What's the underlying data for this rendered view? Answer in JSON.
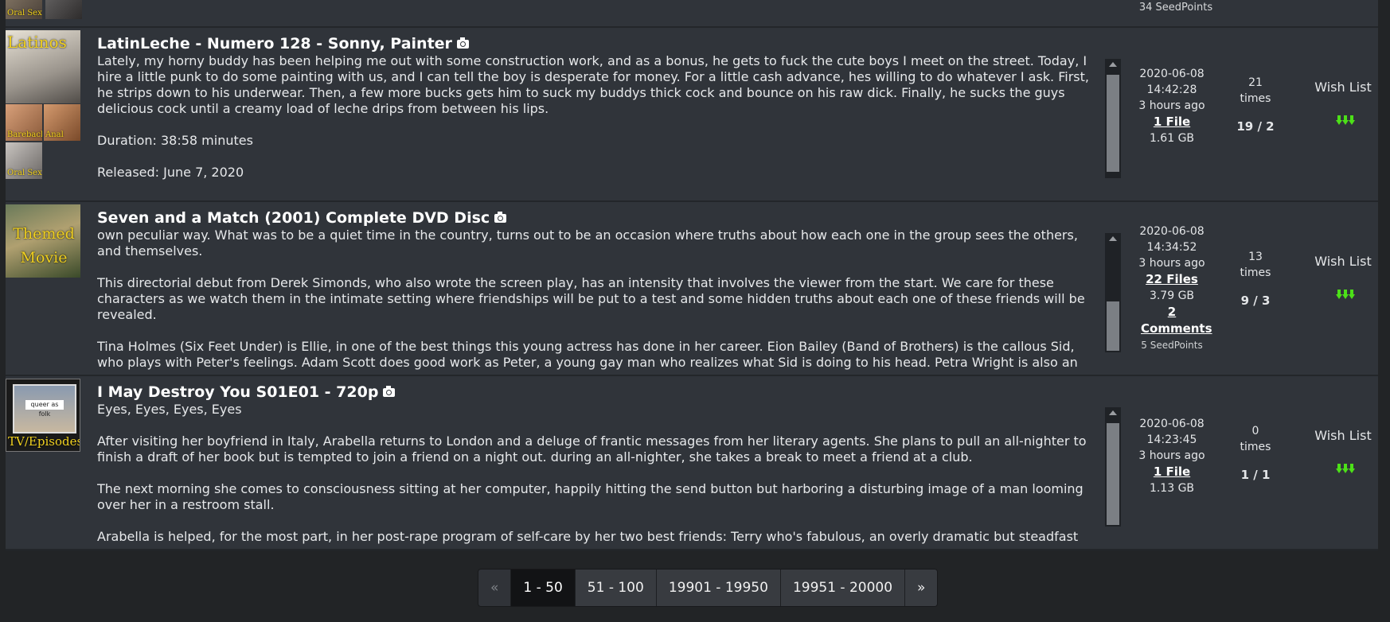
{
  "previous_row": {
    "seedpoints": "34 SeedPoints",
    "thumb_label": "Oral Sex"
  },
  "items": [
    {
      "title": "LatinLeche - Numero 128 - Sonny, Painter",
      "thumbs": [
        "Latinos",
        "Bareback",
        "Anal",
        "Oral Sex"
      ],
      "description": [
        "Lately, my horny buddy has been helping me out with some construction work, and as a bonus, he gets to fuck the cute boys I meet on the street. Today, I hire a little punk to do some painting with us, and I can tell the boy is desperate for money. For a little cash advance, hes willing to do whatever I ask. First, he strips down to his underwear. Then, a few more bucks gets him to suck my buddys thick cock and bounce on his raw dick. Finally, he sucks the guys delicious cock until a creamy load of leche drips from between his lips.",
        "",
        "Duration: 38:58 minutes",
        "Released: June 7, 2020"
      ],
      "date": "2020-06-08",
      "time": "14:42:28",
      "ago": "3 hours ago",
      "files": "1 File",
      "size": "1.61 GB",
      "times_count": "21",
      "times_label": "times",
      "peers": "19 / 2",
      "wish": "Wish List",
      "download_icon": "download-arrows-icon"
    },
    {
      "title": "Seven and a Match (2001) Complete DVD Disc",
      "thumbs": [
        "Themed Movie"
      ],
      "description": [
        "own peculiar way. What was to be a quiet time in the country, turns out to be an occasion where truths about how each one in the group sees the others, and themselves.",
        "This directorial debut from Derek Simonds, who also wrote the screen play, has an intensity that involves the viewer from the start. We care for these characters as we watch them in the intimate setting where friendships will be put to a test and some hidden truths about each one of these friends will be revealed.",
        "Tina Holmes (Six Feet Under) is Ellie, in one of the best things this young actress has done in her career. Eion Bailey (Band of Brothers) is the callous Sid, who plays with Peter's feelings. Adam Scott does good work as Peter, a young gay man who realizes what Sid is doing to his head. Petra Wright is also an asset in the film as Blair, the apparently superficial girl who betrays Matthew without realizing the consequences of her actions. Heather Donahue is also good as Whit, the girl who seems to have it"
      ],
      "date": "2020-06-08",
      "time": "14:34:52",
      "ago": "3 hours ago",
      "files": "22 Files",
      "size": "3.79 GB",
      "comments": "2 Comments",
      "seedpoints": "5 SeedPoints",
      "times_count": "13",
      "times_label": "times",
      "peers": "9 / 3",
      "wish": "Wish List",
      "download_icon": "download-arrows-icon"
    },
    {
      "title": "I May Destroy You S01E01 - 720p",
      "thumbs": [
        "TV/Episodes",
        "queer as folk"
      ],
      "description": [
        "Eyes, Eyes, Eyes, Eyes",
        "After visiting her boyfriend in Italy, Arabella returns to London and a deluge of frantic messages from her literary agents. She plans to pull an all-nighter to finish a draft of her book but is tempted to join a friend on a night out. during an all-nighter, she takes a break to meet a friend at a club.",
        "The next morning she comes to consciousness sitting at her computer, happily hitting the send button but harboring a disturbing image of a man looming over her in a restroom stall.",
        "Arabella is helped, for the most part, in her post-rape program of self-care by her two best friends: Terry who's fabulous, an overly dramatic but steadfast actress, and"
      ],
      "date": "2020-06-08",
      "time": "14:23:45",
      "ago": "3 hours ago",
      "files": "1 File",
      "size": "1.13 GB",
      "times_count": "0",
      "times_label": "times",
      "peers": "1 / 1",
      "wish": "Wish List",
      "download_icon": "download-arrows-icon"
    }
  ],
  "pagination": {
    "prev": "«",
    "pages": [
      "1 - 50",
      "51 - 100",
      "19901 - 19950",
      "19951 - 20000"
    ],
    "active": "1 - 50",
    "next": "»"
  }
}
